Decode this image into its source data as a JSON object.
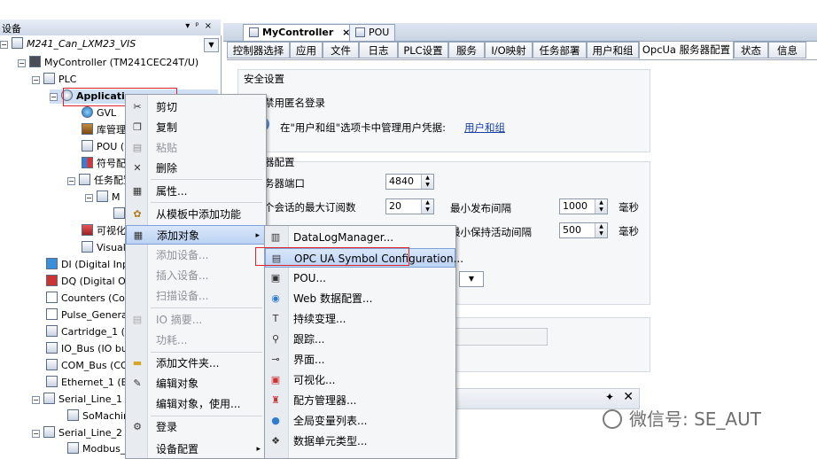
{
  "devices_panel": {
    "title": "设备",
    "header_buttons": [
      "▾",
      "ᵖ",
      "×"
    ],
    "project": "M241_Can_LXM23_VIS",
    "tree": [
      {
        "label": "MyController (TM241CEC24T/U)",
        "icon": "plc-icon"
      },
      {
        "label": "PLC",
        "icon": "plc-logic-icon"
      },
      {
        "label": "Application",
        "icon": "application-icon"
      },
      {
        "label": "GVL",
        "icon": "globe-icon"
      },
      {
        "label": "库管理器",
        "icon": "library-icon"
      },
      {
        "label": "POU (PRG)",
        "icon": "pou-icon"
      },
      {
        "label": "符号配置",
        "icon": "symbol-icon"
      },
      {
        "label": "任务配置",
        "icon": "task-icon"
      },
      {
        "label": "M",
        "icon": "task-item-icon"
      },
      {
        "label": "",
        "icon": "pou-call-icon"
      },
      {
        "label": "可视化",
        "icon": "visu-icon"
      },
      {
        "label": "Visual",
        "icon": "visu-manager-icon"
      },
      {
        "label": "DI (Digital Inpu",
        "icon": "di-icon"
      },
      {
        "label": "DQ (Digital Ou",
        "icon": "dq-icon"
      },
      {
        "label": "Counters (Cou",
        "icon": "counter-icon"
      },
      {
        "label": "Pulse_Generat",
        "icon": "pulse-icon"
      },
      {
        "label": "Cartridge_1 (C",
        "icon": "cartridge-icon"
      },
      {
        "label": "IO_Bus (IO bu",
        "icon": "iobus-icon"
      },
      {
        "label": "COM_Bus (CO",
        "icon": "combus-icon"
      },
      {
        "label": "Ethernet_1 (E",
        "icon": "ethernet-icon"
      },
      {
        "label": "Serial_Line_1 (",
        "icon": "serial-icon"
      },
      {
        "label": "SoMachine",
        "icon": "somachine-icon"
      },
      {
        "label": "Serial_Line_2 (",
        "icon": "serial-icon"
      },
      {
        "label": "Modbus_M",
        "icon": "modbus-icon"
      }
    ]
  },
  "doc_tabs": [
    {
      "label": "MyController",
      "close": "×"
    },
    {
      "label": "POU"
    }
  ],
  "sub_tabs": [
    "控制器选择",
    "应用",
    "文件",
    "日志",
    "PLC设置",
    "服务",
    "I/O映射",
    "任务部署",
    "用户和组",
    "OpcUa 服务器配置",
    "状态",
    "信息"
  ],
  "security": {
    "title": "安全设置",
    "disable_anon": "禁用匿名登录",
    "user_mgmt_text": "在\"用户和组\"选项卡中管理用户凭据:",
    "user_mgmt_link": "用户和组"
  },
  "server": {
    "title": "器配置",
    "port_label": "务器端口",
    "port_value": "4840",
    "max_sub_label": "个会话的最大订阅数",
    "max_sub_value": "20",
    "min_pub_label": "最小发布间隔",
    "min_pub_value": "1000",
    "min_pub_unit": "毫秒",
    "min_keep_label": "最小保持活动间隔",
    "min_keep_value": "500",
    "min_keep_unit": "毫秒"
  },
  "context_menu": [
    {
      "label": "剪切",
      "icon": "scissors-icon",
      "enabled": true
    },
    {
      "label": "复制",
      "icon": "copy-icon",
      "enabled": true
    },
    {
      "label": "粘贴",
      "icon": "paste-icon",
      "enabled": false
    },
    {
      "label": "删除",
      "icon": "delete-icon",
      "enabled": true
    },
    {
      "label": "属性...",
      "icon": "properties-icon",
      "enabled": true
    },
    {
      "label": "从模板中添加功能",
      "icon": "template-icon",
      "enabled": true
    },
    {
      "label": "添加对象",
      "icon": "add-object-icon",
      "enabled": true,
      "highlight": true,
      "submenu": "▸"
    },
    {
      "label": "添加设备...",
      "icon": "",
      "enabled": false
    },
    {
      "label": "插入设备...",
      "icon": "",
      "enabled": false
    },
    {
      "label": "扫描设备...",
      "icon": "",
      "enabled": false
    },
    {
      "label": "IO 摘要...",
      "icon": "io-summary-icon",
      "enabled": false
    },
    {
      "label": "功耗...",
      "icon": "",
      "enabled": false
    },
    {
      "label": "添加文件夹...",
      "icon": "folder-icon",
      "enabled": true
    },
    {
      "label": "编辑对象",
      "icon": "edit-icon",
      "enabled": true
    },
    {
      "label": "编辑对象，使用...",
      "icon": "",
      "enabled": true
    },
    {
      "label": "登录",
      "icon": "login-icon",
      "enabled": true
    },
    {
      "label": "设备配置",
      "icon": "",
      "enabled": true,
      "submenu": "▸"
    }
  ],
  "submenu": [
    {
      "label": "DataLogManager...",
      "icon": "datalog-icon"
    },
    {
      "label": "OPC UA Symbol Configuration...",
      "icon": "opcua-icon",
      "highlight": true
    },
    {
      "label": "POU...",
      "icon": "pou-icon"
    },
    {
      "label": "Web 数据配置...",
      "icon": "web-icon"
    },
    {
      "label": "持续变理...",
      "icon": "persistent-icon"
    },
    {
      "label": "跟踪...",
      "icon": "trace-icon"
    },
    {
      "label": "界面...",
      "icon": "interface-icon"
    },
    {
      "label": "可视化...",
      "icon": "visu-icon"
    },
    {
      "label": "配方管理器...",
      "icon": "recipe-icon"
    },
    {
      "label": "全局变量列表...",
      "icon": "gvl-icon"
    },
    {
      "label": "数据单元类型...",
      "icon": "dut-icon"
    }
  ],
  "watermark": "微信号: SE_AUT"
}
